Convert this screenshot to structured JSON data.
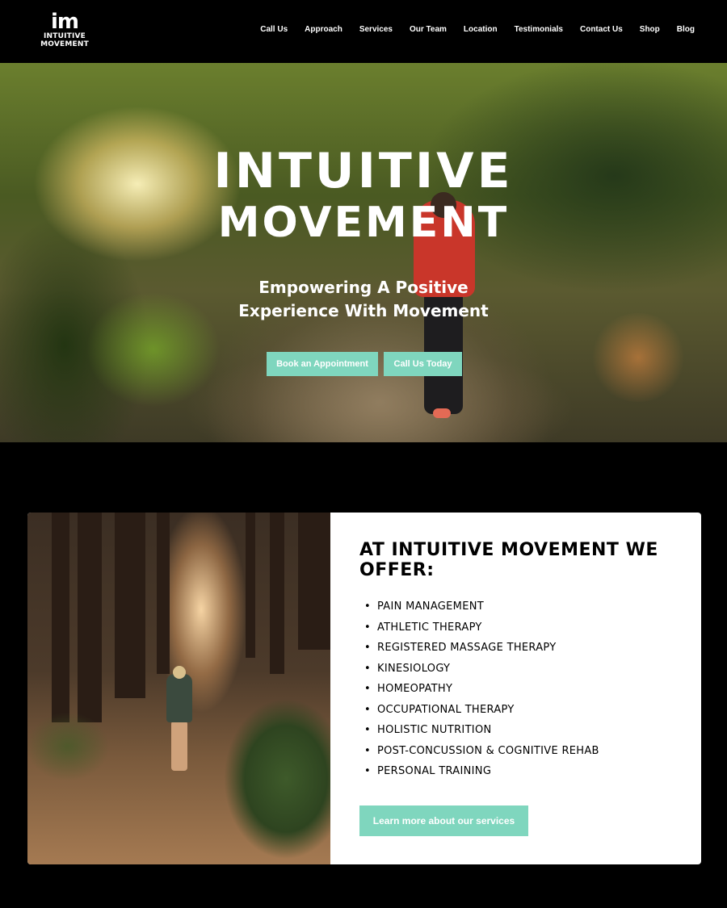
{
  "header": {
    "logo": {
      "mark": "im",
      "line1": "INTUITIVE",
      "line2": "MOVEMENT"
    },
    "nav": [
      {
        "label": "Call Us"
      },
      {
        "label": "Approach"
      },
      {
        "label": "Services"
      },
      {
        "label": "Our Team"
      },
      {
        "label": "Location"
      },
      {
        "label": "Testimonials"
      },
      {
        "label": "Contact Us"
      },
      {
        "label": "Shop"
      },
      {
        "label": "Blog"
      }
    ]
  },
  "hero": {
    "title_line1": "INTUITIVE",
    "title_line2": "MOVEMENT",
    "subtitle_line1": "Empowering A Positive",
    "subtitle_line2": "Experience With Movement",
    "book_button": "Book an Appointment",
    "call_button": "Call Us Today"
  },
  "offer": {
    "title": "AT INTUITIVE MOVEMENT WE OFFER:",
    "items": [
      "PAIN MANAGEMENT",
      "ATHLETIC THERAPY",
      "REGISTERED MASSAGE THERAPY",
      "KINESIOLOGY",
      "HOMEOPATHY",
      "OCCUPATIONAL THERAPY",
      "HOLISTIC NUTRITION",
      "POST-CONCUSSION & COGNITIVE REHAB",
      "PERSONAL TRAINING"
    ],
    "learn_button": "Learn more about our services"
  },
  "colors": {
    "accent": "#7fd6be",
    "background": "#000000",
    "card": "#ffffff"
  }
}
